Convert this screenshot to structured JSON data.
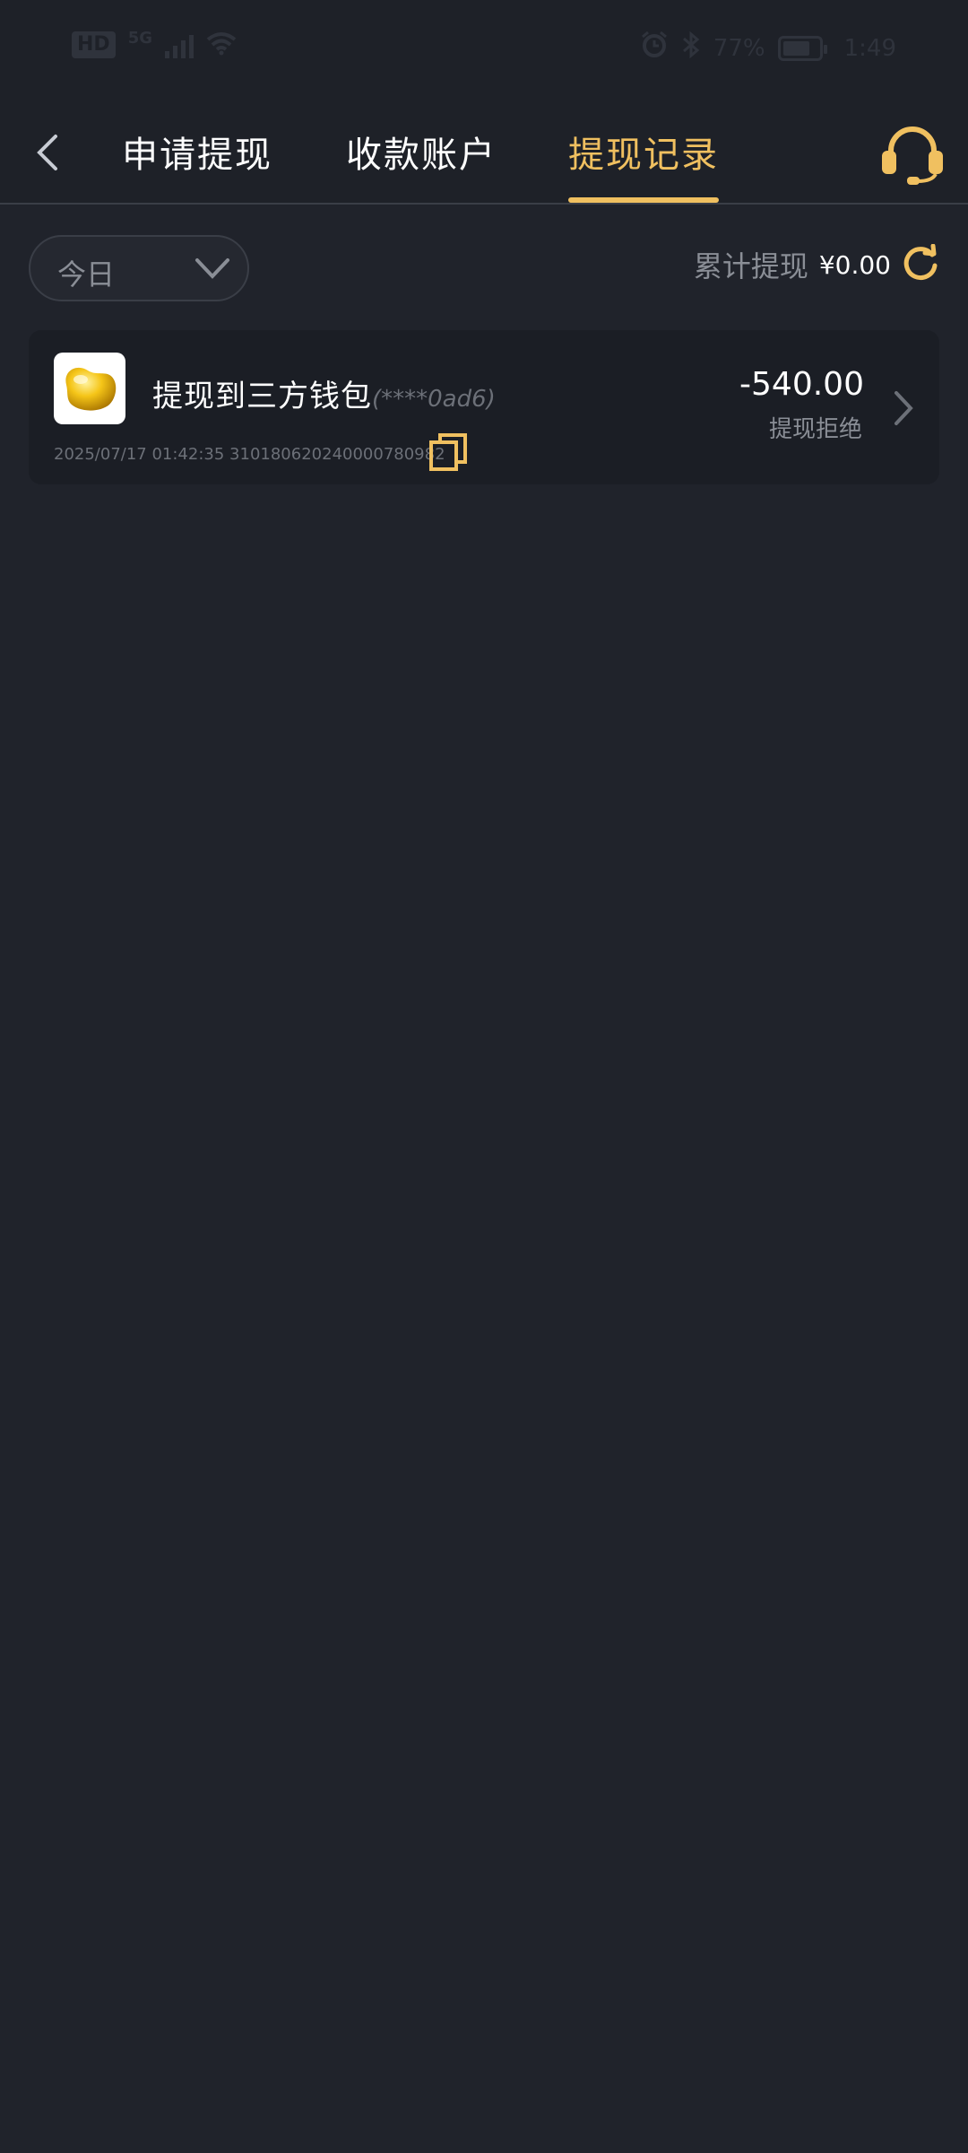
{
  "status_bar": {
    "network_hd": "HD",
    "network_type": "5G",
    "battery_percent_text": "77%",
    "battery_level": 0.77,
    "time": "1:49"
  },
  "header": {
    "tabs": [
      {
        "label": "申请提现",
        "active": false
      },
      {
        "label": "收款账户",
        "active": false
      },
      {
        "label": "提现记录",
        "active": true
      }
    ]
  },
  "filter": {
    "date_selected": "今日",
    "total_label": "累计提现",
    "total_value": "¥0.00"
  },
  "records": [
    {
      "title": "提现到三方钱包",
      "account": "(****0ad6)",
      "datetime": "2025/07/17 01:42:35",
      "order_no": "3101806202400007809​82",
      "amount": "-540.00",
      "status": "提现拒绝"
    }
  ],
  "colors": {
    "background": "#20232b",
    "accent": "#f0c060",
    "card": "#1b1e25",
    "muted_text": "#8a8e96"
  },
  "icons": {
    "back": "chevron-left-icon",
    "support": "headset-icon",
    "date_dropdown": "chevron-down-icon",
    "refresh": "refresh-icon",
    "copy": "copy-icon",
    "detail": "chevron-right-icon"
  }
}
